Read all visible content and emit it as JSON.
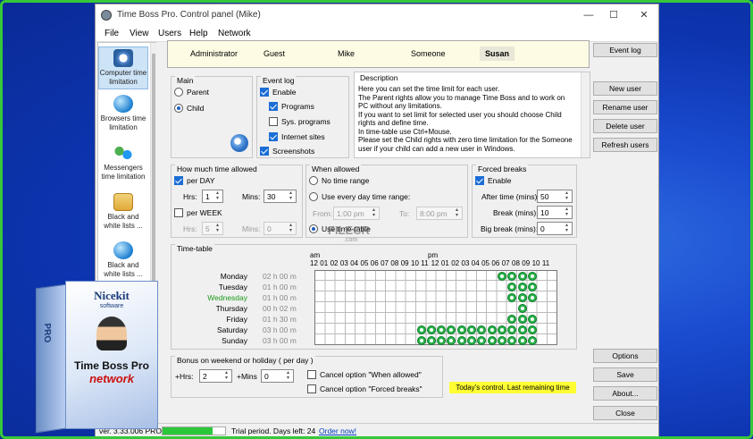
{
  "window": {
    "title": "Time Boss Pro. Control panel (Mike)",
    "controls": [
      "—",
      "☐",
      "✕"
    ]
  },
  "menu": [
    "File",
    "View",
    "Users",
    "Help",
    "Network"
  ],
  "sidebar": [
    {
      "label": "Computer time limitation",
      "icon": "clock-icon"
    },
    {
      "label": "Browsers time limitation",
      "icon": "globe-icon"
    },
    {
      "label": "Messengers time limitation",
      "icon": "messenger-icon"
    },
    {
      "label": "Black and white lists ...",
      "icon": "list-icon"
    },
    {
      "label": "Black and white lists ...",
      "icon": "list-globe-icon"
    }
  ],
  "users": {
    "names": [
      "Administrator",
      "Guest",
      "Mike",
      "Someone",
      "Susan"
    ],
    "selected": "Susan"
  },
  "buttons": {
    "event_log": "Event log",
    "new_user": "New user",
    "rename_user": "Rename user",
    "delete_user": "Delete user",
    "refresh_users": "Refresh users",
    "options": "Options",
    "save": "Save",
    "about": "About...",
    "close": "Close"
  },
  "main": {
    "title": "Main",
    "parent": "Parent",
    "child": "Child",
    "selected": "Child"
  },
  "event_log": {
    "title": "Event log",
    "enable": "Enable",
    "programs": "Programs",
    "sys_programs": "Sys. programs",
    "internet_sites": "Internet sites",
    "screenshots": "Screenshots"
  },
  "description": {
    "title": "Description",
    "text": "Here you can set the time limit for each user.\nThe Parent rights allow you to manage Time Boss and to work on PC without any limitations.\nIf you want to set limit for selected user you should choose Child rights and define time.\nIn time-table use Ctrl+Mouse.\nPlease set the Child rights with zero time limitation for the Someone user if your child can add a new user in Windows."
  },
  "how_much": {
    "title": "How much time allowed",
    "per_day": "per DAY",
    "per_week": "per WEEK",
    "hrs": "Hrs:",
    "mins": "Mins:",
    "day_hrs": "1",
    "day_mins": "30",
    "week_hrs": "5",
    "week_mins": "0"
  },
  "when_allowed": {
    "title": "When allowed",
    "no_range": "No time range",
    "every_day": "Use every day time range:",
    "from": "From:",
    "to": "To:",
    "from_val": "1:00 pm",
    "to_val": "8:00 pm",
    "use_table": "Use time-table"
  },
  "forced_breaks": {
    "title": "Forced breaks",
    "enable": "Enable",
    "after_time": "After time (mins):",
    "break": "Break (mins):",
    "big_break": "Big break (mins):",
    "after_val": "50",
    "break_val": "10",
    "big_val": "0"
  },
  "timetable": {
    "title": "Time-table",
    "am": "am",
    "pm": "pm",
    "hours": [
      "12",
      "01",
      "02",
      "03",
      "04",
      "05",
      "06",
      "07",
      "08",
      "09",
      "10",
      "11",
      "12",
      "01",
      "02",
      "03",
      "04",
      "05",
      "06",
      "07",
      "08",
      "09",
      "10",
      "11"
    ],
    "days": [
      {
        "day": "Monday",
        "time": "02 h 00 m"
      },
      {
        "day": "Tuesday",
        "time": "01 h 00 m"
      },
      {
        "day": "Wednesday",
        "time": "01 h 00 m"
      },
      {
        "day": "Thursday",
        "time": "00 h 02 m"
      },
      {
        "day": "Friday",
        "time": "01 h 30 m"
      },
      {
        "day": "Saturday",
        "time": "03 h 00 m"
      },
      {
        "day": "Sunday",
        "time": "03 h 00 m"
      }
    ]
  },
  "bonus": {
    "title": "Bonus on weekend or holiday ( per day )",
    "hrs": "+Hrs:",
    "mins": "+Mins",
    "hrs_val": "2",
    "mins_val": "0",
    "cancel_when": "Cancel option \"When allowed\"",
    "cancel_forced": "Cancel option \"Forced breaks\""
  },
  "today": "Today's control. Last remaining time",
  "status": {
    "version": "ver. 3.33.006 PRO",
    "trial": "Trial period. Days left: 24",
    "order": "Order now!",
    "progress": 0.8
  },
  "watermark": {
    "main": "FILECR",
    "sub": ".com"
  },
  "box": {
    "brand": "Nicekit",
    "brand_sub": "software",
    "product": "Time Boss Pro",
    "edition": "network",
    "side": "PRO"
  },
  "colors": {
    "accent": "#1c6ed6",
    "active": "#2bb34a",
    "highlight": "#ffff33",
    "wednesday": "#1a9a1a"
  }
}
